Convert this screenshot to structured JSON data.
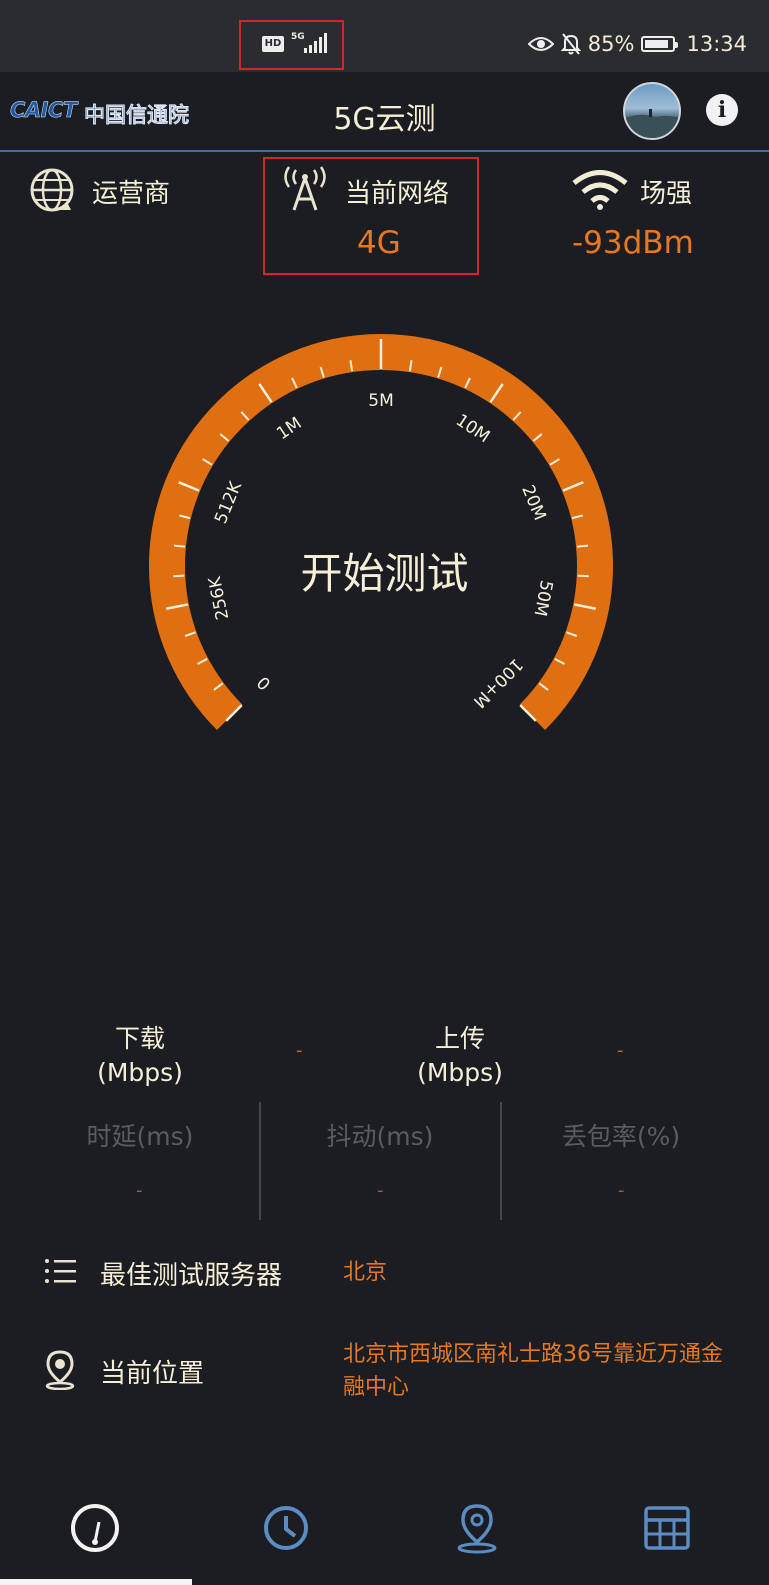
{
  "status_bar": {
    "hd_label": "HD",
    "network_small": "5G",
    "battery_pct": 85,
    "battery_text": "85%",
    "time": "13:34"
  },
  "header": {
    "logo_mark": "CAICT",
    "logo_cn": "中国信通院",
    "title": "5G云测"
  },
  "stats": {
    "operator_label": "运营商",
    "network_label": "当前网络",
    "network_value": "4G",
    "signal_label": "场强",
    "signal_value": "-93dBm"
  },
  "gauge": {
    "scale_labels": [
      "0",
      "256K",
      "512K",
      "1M",
      "5M",
      "10M",
      "20M",
      "50M",
      "100+M"
    ],
    "start_label": "开始测试",
    "accent_color": "#e06f12"
  },
  "metrics": {
    "download_label": "下载",
    "download_unit": "(Mbps)",
    "download_value": "-",
    "upload_label": "上传",
    "upload_unit": "(Mbps)",
    "upload_value": "-",
    "latency_label": "时延(ms)",
    "latency_value": "-",
    "jitter_label": "抖动(ms)",
    "jitter_value": "-",
    "loss_label": "丢包率(%)",
    "loss_value": "-"
  },
  "server": {
    "label": "最佳测试服务器",
    "value": "北京"
  },
  "location": {
    "label": "当前位置",
    "line1": "北京市西城区南礼士路36号靠近万通金",
    "line2": "融中心"
  },
  "nav": {
    "items": [
      "speedometer-icon",
      "history-clock-icon",
      "map-pin-icon",
      "grid-table-icon"
    ],
    "active_color": "#f2f2f2",
    "inactive_color": "#5b8cc4"
  }
}
